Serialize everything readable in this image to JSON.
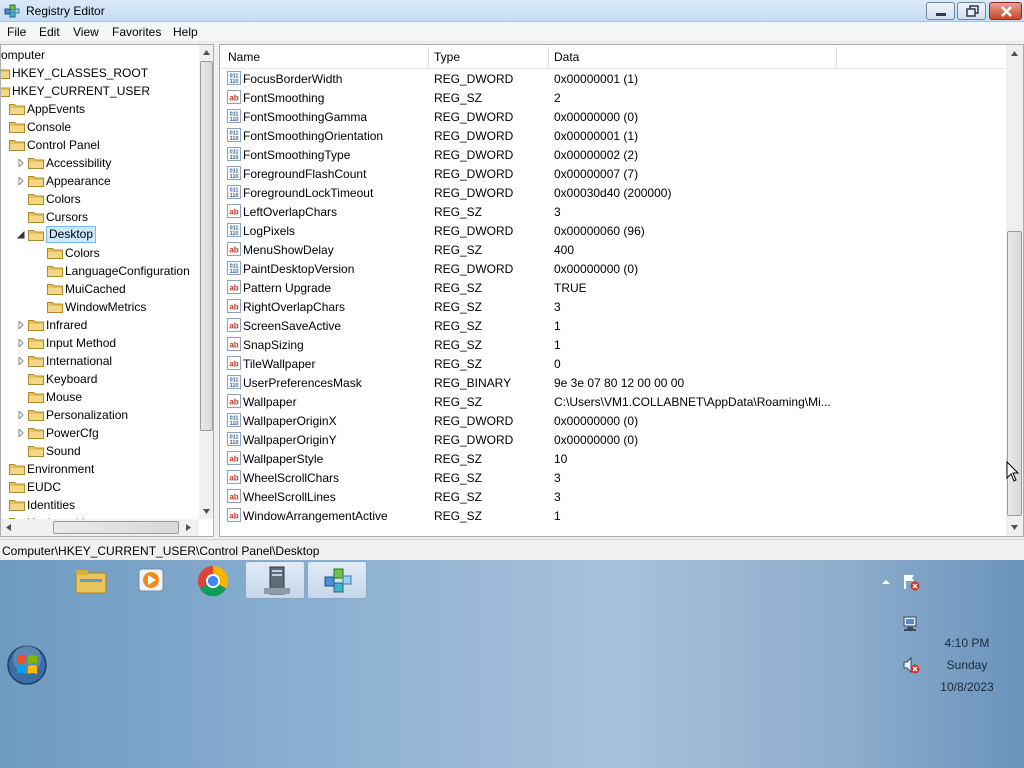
{
  "window": {
    "title": "Registry Editor"
  },
  "menu": [
    "File",
    "Edit",
    "View",
    "Favorites",
    "Help"
  ],
  "tree": [
    {
      "label": "omputer",
      "depth": 0,
      "expander": "none"
    },
    {
      "label": "HKEY_CLASSES_ROOT",
      "depth": 0,
      "expander": "none"
    },
    {
      "label": "HKEY_CURRENT_USER",
      "depth": 0,
      "expander": "none"
    },
    {
      "label": "AppEvents",
      "depth": 1,
      "expander": "none"
    },
    {
      "label": "Console",
      "depth": 1,
      "expander": "none"
    },
    {
      "label": "Control Panel",
      "depth": 1,
      "expander": "none"
    },
    {
      "label": "Accessibility",
      "depth": 2,
      "expander": "collapsed"
    },
    {
      "label": "Appearance",
      "depth": 2,
      "expander": "collapsed"
    },
    {
      "label": "Colors",
      "depth": 2,
      "expander": "none"
    },
    {
      "label": "Cursors",
      "depth": 2,
      "expander": "none"
    },
    {
      "label": "Desktop",
      "depth": 2,
      "expander": "expanded",
      "selected": true
    },
    {
      "label": "Colors",
      "depth": 3,
      "expander": "none"
    },
    {
      "label": "LanguageConfiguration",
      "depth": 3,
      "expander": "none"
    },
    {
      "label": "MuiCached",
      "depth": 3,
      "expander": "none"
    },
    {
      "label": "WindowMetrics",
      "depth": 3,
      "expander": "none"
    },
    {
      "label": "Infrared",
      "depth": 2,
      "expander": "collapsed"
    },
    {
      "label": "Input Method",
      "depth": 2,
      "expander": "collapsed"
    },
    {
      "label": "International",
      "depth": 2,
      "expander": "collapsed"
    },
    {
      "label": "Keyboard",
      "depth": 2,
      "expander": "none"
    },
    {
      "label": "Mouse",
      "depth": 2,
      "expander": "none"
    },
    {
      "label": "Personalization",
      "depth": 2,
      "expander": "collapsed"
    },
    {
      "label": "PowerCfg",
      "depth": 2,
      "expander": "collapsed"
    },
    {
      "label": "Sound",
      "depth": 2,
      "expander": "none"
    },
    {
      "label": "Environment",
      "depth": 1,
      "expander": "none"
    },
    {
      "label": "EUDC",
      "depth": 1,
      "expander": "none"
    },
    {
      "label": "Identities",
      "depth": 1,
      "expander": "none"
    },
    {
      "label": "Keyboard Layout",
      "depth": 1,
      "expander": "none"
    }
  ],
  "list": {
    "columns": [
      "Name",
      "Type",
      "Data"
    ],
    "rows": [
      {
        "icon": "binary-value-icon",
        "name": "FocusBorderWidth",
        "type": "REG_DWORD",
        "data": "0x00000001 (1)"
      },
      {
        "icon": "string-value-icon",
        "name": "FontSmoothing",
        "type": "REG_SZ",
        "data": "2"
      },
      {
        "icon": "binary-value-icon",
        "name": "FontSmoothingGamma",
        "type": "REG_DWORD",
        "data": "0x00000000 (0)"
      },
      {
        "icon": "binary-value-icon",
        "name": "FontSmoothingOrientation",
        "type": "REG_DWORD",
        "data": "0x00000001 (1)"
      },
      {
        "icon": "binary-value-icon",
        "name": "FontSmoothingType",
        "type": "REG_DWORD",
        "data": "0x00000002 (2)"
      },
      {
        "icon": "binary-value-icon",
        "name": "ForegroundFlashCount",
        "type": "REG_DWORD",
        "data": "0x00000007 (7)"
      },
      {
        "icon": "binary-value-icon",
        "name": "ForegroundLockTimeout",
        "type": "REG_DWORD",
        "data": "0x00030d40 (200000)"
      },
      {
        "icon": "string-value-icon",
        "name": "LeftOverlapChars",
        "type": "REG_SZ",
        "data": "3"
      },
      {
        "icon": "binary-value-icon",
        "name": "LogPixels",
        "type": "REG_DWORD",
        "data": "0x00000060 (96)"
      },
      {
        "icon": "string-value-icon",
        "name": "MenuShowDelay",
        "type": "REG_SZ",
        "data": "400"
      },
      {
        "icon": "binary-value-icon",
        "name": "PaintDesktopVersion",
        "type": "REG_DWORD",
        "data": "0x00000000 (0)"
      },
      {
        "icon": "string-value-icon",
        "name": "Pattern Upgrade",
        "type": "REG_SZ",
        "data": "TRUE"
      },
      {
        "icon": "string-value-icon",
        "name": "RightOverlapChars",
        "type": "REG_SZ",
        "data": "3"
      },
      {
        "icon": "string-value-icon",
        "name": "ScreenSaveActive",
        "type": "REG_SZ",
        "data": "1"
      },
      {
        "icon": "string-value-icon",
        "name": "SnapSizing",
        "type": "REG_SZ",
        "data": "1"
      },
      {
        "icon": "string-value-icon",
        "name": "TileWallpaper",
        "type": "REG_SZ",
        "data": "0"
      },
      {
        "icon": "binary-value-icon",
        "name": "UserPreferencesMask",
        "type": "REG_BINARY",
        "data": "9e 3e 07 80 12 00 00 00"
      },
      {
        "icon": "string-value-icon",
        "name": "Wallpaper",
        "type": "REG_SZ",
        "data": "C:\\Users\\VM1.COLLABNET\\AppData\\Roaming\\Mi..."
      },
      {
        "icon": "binary-value-icon",
        "name": "WallpaperOriginX",
        "type": "REG_DWORD",
        "data": "0x00000000 (0)"
      },
      {
        "icon": "binary-value-icon",
        "name": "WallpaperOriginY",
        "type": "REG_DWORD",
        "data": "0x00000000 (0)"
      },
      {
        "icon": "string-value-icon",
        "name": "WallpaperStyle",
        "type": "REG_SZ",
        "data": "10"
      },
      {
        "icon": "string-value-icon",
        "name": "WheelScrollChars",
        "type": "REG_SZ",
        "data": "3"
      },
      {
        "icon": "string-value-icon",
        "name": "WheelScrollLines",
        "type": "REG_SZ",
        "data": "3"
      },
      {
        "icon": "string-value-icon",
        "name": "WindowArrangementActive",
        "type": "REG_SZ",
        "data": "1"
      }
    ]
  },
  "status": {
    "path": "Computer\\HKEY_CURRENT_USER\\Control Panel\\Desktop"
  },
  "taskbar": {
    "apps": [
      {
        "name": "file-explorer-icon",
        "open": false
      },
      {
        "name": "media-player-icon",
        "open": false
      },
      {
        "name": "chrome-icon",
        "open": false
      },
      {
        "name": "server-manager-icon",
        "open": true
      },
      {
        "name": "registry-editor-icon",
        "open": true
      }
    ],
    "tray_icons": [
      "show-hidden-icons-icon",
      "action-center-warning-icon",
      "network-icon",
      "volume-muted-icon"
    ],
    "clock": {
      "time": "4:10 PM",
      "day": "Sunday",
      "date": "10/8/2023"
    }
  },
  "colors": {
    "selection": "#cde8ff",
    "folder": "#e8c25a",
    "titlebar": "#c6dcf3",
    "close_button": "#c9452b"
  }
}
